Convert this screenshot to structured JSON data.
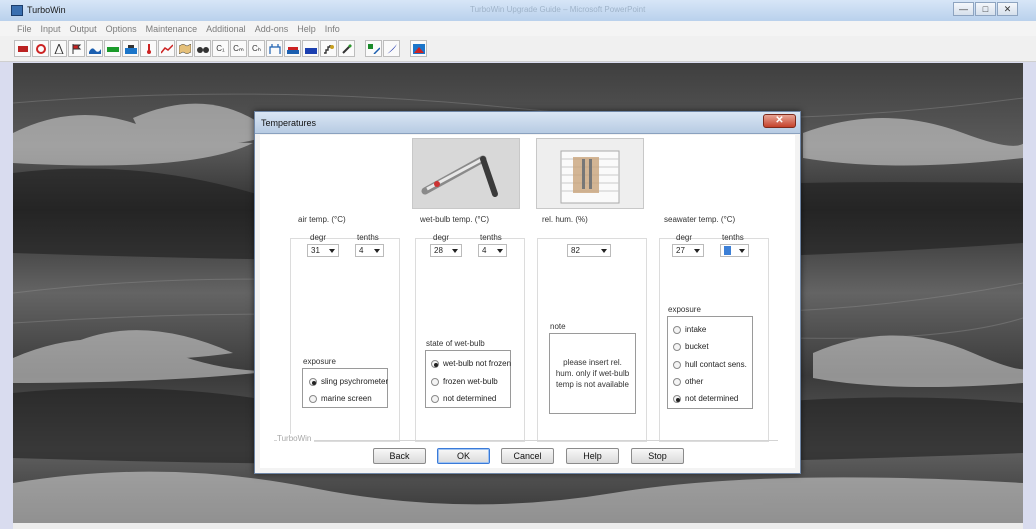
{
  "app": {
    "title": "TurboWin",
    "background_window_title": "TurboWin Upgrade Guide – Microsoft PowerPoint"
  },
  "menubar": [
    "File",
    "Input",
    "Output",
    "Options",
    "Maintenance",
    "Additional",
    "Add-ons",
    "Help",
    "Info"
  ],
  "toolbar": {
    "text_buttons": [
      "C₁",
      "Cₘ",
      "Cₕ"
    ]
  },
  "dialog": {
    "title": "Temperatures",
    "close_label": "✕",
    "air": {
      "title": "air temp. (°C)",
      "degr_label": "degr",
      "tenths_label": "tenths",
      "degr_value": "31",
      "tenths_value": "4",
      "exposure_title": "exposure",
      "exposure_options": [
        "sling psychrometer",
        "marine screen"
      ],
      "exposure_selected": 0
    },
    "wetbulb": {
      "title": "wet-bulb temp. (°C)",
      "degr_label": "degr",
      "tenths_label": "tenths",
      "degr_value": "28",
      "tenths_value": "4",
      "state_title": "state of wet-bulb",
      "state_options": [
        "wet-bulb not frozen",
        "frozen wet-bulb",
        "not determined"
      ],
      "state_selected": 0
    },
    "relhum": {
      "title": "rel. hum. (%)",
      "value": "82",
      "note_title": "note",
      "note_text": "please insert rel. hum. only if wet-bulb temp is not available"
    },
    "seawater": {
      "title": "seawater temp. (°C)",
      "degr_label": "degr",
      "tenths_label": "tenths",
      "degr_value": "27",
      "tenths_value": "",
      "exposure_title": "exposure",
      "exposure_options": [
        "intake",
        "bucket",
        "hull contact sens.",
        "other",
        "not determined"
      ],
      "exposure_selected": 4
    },
    "group_label": "TurboWin",
    "buttons": {
      "back": "Back",
      "ok": "OK",
      "cancel": "Cancel",
      "help": "Help",
      "stop": "Stop"
    }
  }
}
